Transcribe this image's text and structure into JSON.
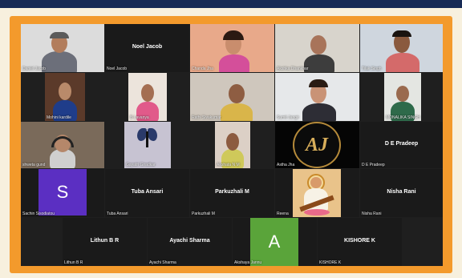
{
  "participants": [
    {
      "id": "p1",
      "name": "Daniel Jacob",
      "has_video": true
    },
    {
      "id": "p2",
      "name": "Noel Jacob",
      "big_name": "Noel Jacob",
      "has_video": false
    },
    {
      "id": "p3",
      "name": "Chanda Jha",
      "has_video": true
    },
    {
      "id": "p4",
      "name": "Akshka Dhankhar",
      "has_video": true
    },
    {
      "id": "p5",
      "name": "Tilak Singh",
      "has_video": true
    },
    {
      "id": "p6",
      "name": "Mohini kardile",
      "has_video": true
    },
    {
      "id": "p7",
      "name": "B Lavanya",
      "has_video": true
    },
    {
      "id": "p8",
      "name": "Rathi Sivakumar",
      "has_video": true
    },
    {
      "id": "p9",
      "name": "Sumit Jangir",
      "has_video": true
    },
    {
      "id": "p10",
      "name": "MONALIKA SINGH",
      "has_video": true
    },
    {
      "id": "p11",
      "name": "shweta gund",
      "has_video": true
    },
    {
      "id": "p12",
      "name": "Gayatri Giradkar",
      "has_video": true
    },
    {
      "id": "p13",
      "name": "Akshata N M",
      "has_video": true
    },
    {
      "id": "p14",
      "name": "Astha Jha",
      "logo_text": "AJ",
      "has_video": false
    },
    {
      "id": "p15",
      "name": "D E Pradeep",
      "big_name": "D E Pradeep",
      "has_video": false
    },
    {
      "id": "p16",
      "name": "Sachin Sisodiatou",
      "avatar_letter": "S",
      "has_video": false
    },
    {
      "id": "p17",
      "name": "Tuba Ansari",
      "big_name": "Tuba Ansari",
      "has_video": false
    },
    {
      "id": "p18",
      "name": "Parkuzhali M",
      "big_name": "Parkuzhali M",
      "has_video": false
    },
    {
      "id": "p19",
      "name": "Reena",
      "has_video": true
    },
    {
      "id": "p20",
      "name": "Nisha Rani",
      "big_name": "Nisha Rani",
      "has_video": false
    },
    {
      "id": "p21",
      "name": "Lithun B R",
      "big_name": "Lithun B R",
      "has_video": false
    },
    {
      "id": "p22",
      "name": "Ayachi Sharma",
      "big_name": "Ayachi Sharma",
      "has_video": false
    },
    {
      "id": "p23",
      "name": "Akshaya Jannu",
      "avatar_letter": "A",
      "has_video": false
    },
    {
      "id": "p24",
      "name": "KISHORE K",
      "big_name": "KISHORE K",
      "has_video": false
    }
  ],
  "colors": {
    "frame_orange": "#f39a2c",
    "avatar_purple": "#5b2fc2",
    "avatar_green": "#5aa43a",
    "grid_background": "#1f1f1f"
  }
}
